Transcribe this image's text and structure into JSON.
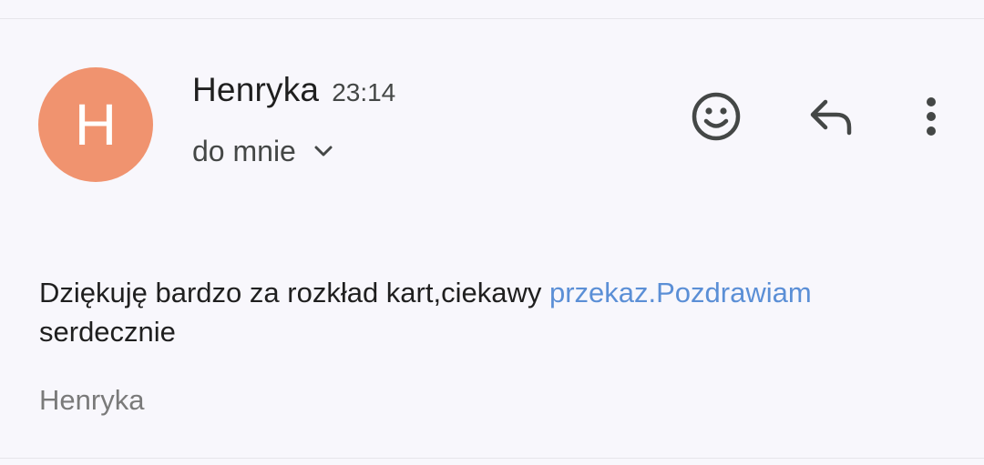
{
  "message": {
    "avatar_letter": "H",
    "sender_name": "Henryka",
    "time": "23:14",
    "recipient": "do mnie",
    "body_prefix": "Dziękuję bardzo za rozkład kart,ciekawy ",
    "body_link": "przekaz.Pozdrawiam",
    "body_suffix": "serdecznie",
    "signature": "Henryka"
  },
  "actions": {
    "emoji_icon": "add-reaction-icon",
    "reply_icon": "reply-icon",
    "more_icon": "more-vert-icon"
  },
  "colors": {
    "avatar_bg": "#f0936f",
    "link": "#5b8fd6",
    "background": "#f8f7fc"
  }
}
